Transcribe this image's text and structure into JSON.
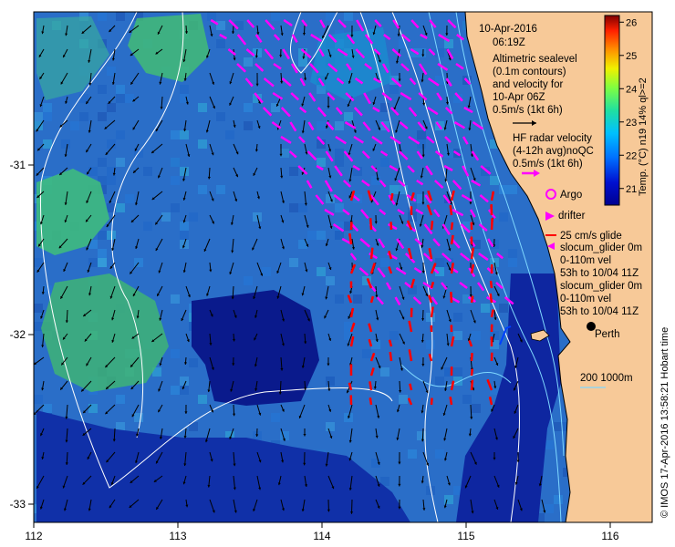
{
  "title_block": {
    "date": "10-Apr-2016",
    "time": "06:19Z",
    "altimetry_lines": [
      "Altimetric sealevel",
      "(0.1m contours)",
      "and velocity for",
      "10-Apr 06Z",
      "0.5m/s (1kt 6h)"
    ],
    "hf_lines": [
      "HF radar velocity",
      "(4-12h avg)noQC",
      "0.5m/s (1kt 6h)"
    ],
    "argo_label": "Argo",
    "drifter_label": "drifter",
    "glider_lines": [
      "25 cm/s glide",
      "slocum_glider 0m",
      "0-110m vel",
      "53h to 10/04 11Z",
      "slocum_glider 0m",
      "0-110m vel",
      "53h to 10/04 11Z"
    ]
  },
  "colorbar": {
    "label": "Temp. (°C) n19 14% ql>=2",
    "ticks": [
      "26",
      "25",
      "24",
      "23",
      "22",
      "21"
    ],
    "min": 20.5,
    "max": 26.2
  },
  "axes": {
    "x_ticks": [
      "112",
      "113",
      "114",
      "115",
      "116"
    ],
    "y_ticks": [
      "-31",
      "-32",
      "-33"
    ],
    "lon_range": [
      112,
      116.3
    ],
    "lat_range": [
      -33.1,
      -30.1
    ]
  },
  "places": {
    "perth": "Perth",
    "depth_legend": "200 1000m"
  },
  "credit": "© IMOS 17-Apr-2016 13:58:21 Hobart time",
  "colors": {
    "land": "#f7c998",
    "altimetry_arrow": "#000000",
    "hf_arrow": "#ff00ff",
    "glider_arrow": "#ff0000",
    "contour": "#ffffff"
  }
}
